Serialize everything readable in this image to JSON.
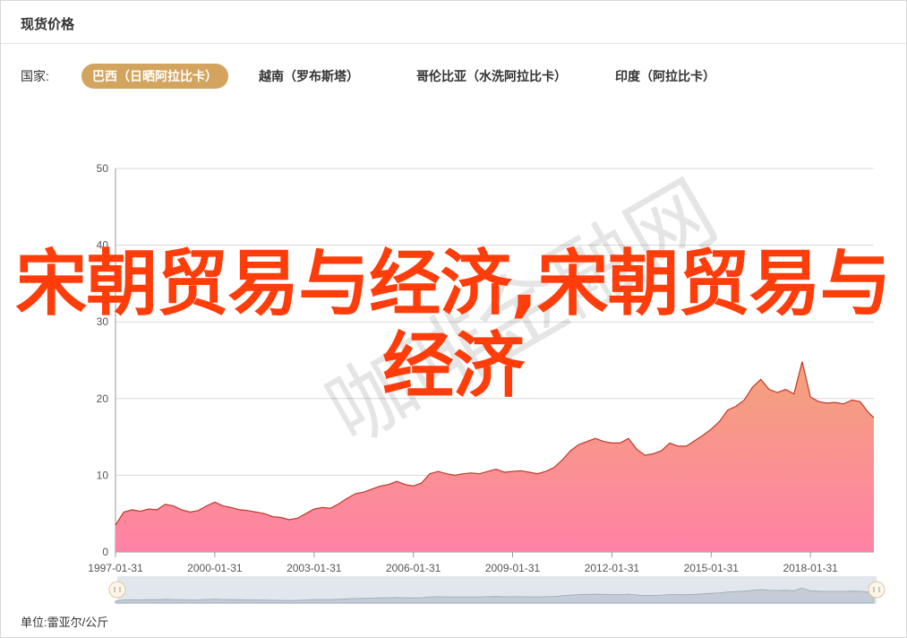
{
  "header": {
    "title": "现货价格"
  },
  "filter": {
    "label": "国家:",
    "tabs": [
      {
        "label": "巴西（日晒阿拉比卡）",
        "active": true
      },
      {
        "label": "越南（罗布斯塔）",
        "active": false
      },
      {
        "label": "哥伦比亚（水洗阿拉比卡）",
        "active": false
      },
      {
        "label": "印度（阿拉比卡）",
        "active": false
      }
    ]
  },
  "overlay_text": "宋朝贸易与经济,宋朝贸易与经济",
  "watermark_text": "咖啡金融网",
  "unit": {
    "label": "单位:",
    "value": "雷亚尔/公斤"
  },
  "colors": {
    "accent": "#d2a45e",
    "line": "#c0392b",
    "fill_top": "#f5a07a",
    "fill_bottom": "#ff7fa0",
    "overlay": "#ff3d0a"
  },
  "chart_data": {
    "type": "area",
    "title": "",
    "xlabel": "",
    "ylabel": "",
    "ylim": [
      0,
      50
    ],
    "yticks": [
      0,
      10,
      20,
      30,
      40,
      50
    ],
    "xticks": [
      "1997-01-31",
      "2000-01-31",
      "2003-01-31",
      "2006-01-31",
      "2009-01-31",
      "2012-01-31",
      "2015-01-31",
      "2018-01-31"
    ],
    "grid": true,
    "series": [
      {
        "x": [
          "1997-01",
          "1997-04",
          "1997-07",
          "1997-10",
          "1998-01",
          "1998-04",
          "1998-07",
          "1998-10",
          "1999-01",
          "1999-04",
          "1999-07",
          "1999-10",
          "2000-01",
          "2000-04",
          "2000-07",
          "2000-10",
          "2001-01",
          "2001-04",
          "2001-07",
          "2001-10",
          "2002-01",
          "2002-04",
          "2002-07",
          "2002-10",
          "2003-01",
          "2003-04",
          "2003-07",
          "2003-10",
          "2004-01",
          "2004-04",
          "2004-07",
          "2004-10",
          "2005-01",
          "2005-04",
          "2005-07",
          "2005-10",
          "2006-01",
          "2006-04",
          "2006-07",
          "2006-10",
          "2007-01",
          "2007-04",
          "2007-07",
          "2007-10",
          "2008-01",
          "2008-04",
          "2008-07",
          "2008-10",
          "2009-01",
          "2009-04",
          "2009-07",
          "2009-10",
          "2010-01",
          "2010-04",
          "2010-07",
          "2010-10",
          "2011-01",
          "2011-04",
          "2011-07",
          "2011-10",
          "2012-01",
          "2012-04",
          "2012-07",
          "2012-10",
          "2013-01",
          "2013-04",
          "2013-07",
          "2013-10",
          "2014-01",
          "2014-04",
          "2014-07",
          "2014-10",
          "2015-01",
          "2015-04",
          "2015-07",
          "2015-10",
          "2016-01",
          "2016-04",
          "2016-07",
          "2016-10",
          "2017-01",
          "2017-04",
          "2017-07",
          "2017-10",
          "2018-01",
          "2018-04",
          "2018-07",
          "2018-10",
          "2019-01",
          "2019-04",
          "2019-07",
          "2019-10",
          "2019-12"
        ],
        "values": [
          3.5,
          5.2,
          5.5,
          5.3,
          5.6,
          5.5,
          6.2,
          6.0,
          5.5,
          5.2,
          5.4,
          6.0,
          6.5,
          6.0,
          5.8,
          5.5,
          5.4,
          5.2,
          5.0,
          4.6,
          4.5,
          4.2,
          4.4,
          5.0,
          5.6,
          5.8,
          5.7,
          6.3,
          7.0,
          7.6,
          7.8,
          8.2,
          8.6,
          8.8,
          9.2,
          8.8,
          8.6,
          9.0,
          10.2,
          10.5,
          10.2,
          10.0,
          10.2,
          10.3,
          10.2,
          10.5,
          10.8,
          10.4,
          10.5,
          10.6,
          10.4,
          10.2,
          10.5,
          11.0,
          12.0,
          13.2,
          14.0,
          14.4,
          14.8,
          14.4,
          14.2,
          14.2,
          14.8,
          13.4,
          12.6,
          12.8,
          13.2,
          14.2,
          13.8,
          13.8,
          14.5,
          15.2,
          16.0,
          17.0,
          18.5,
          19.0,
          19.8,
          21.5,
          22.5,
          21.2,
          20.8,
          21.2,
          20.6,
          24.8,
          20.2,
          19.6,
          19.4,
          19.5,
          19.3,
          19.8,
          19.6,
          18.2,
          17.5
        ]
      }
    ]
  }
}
